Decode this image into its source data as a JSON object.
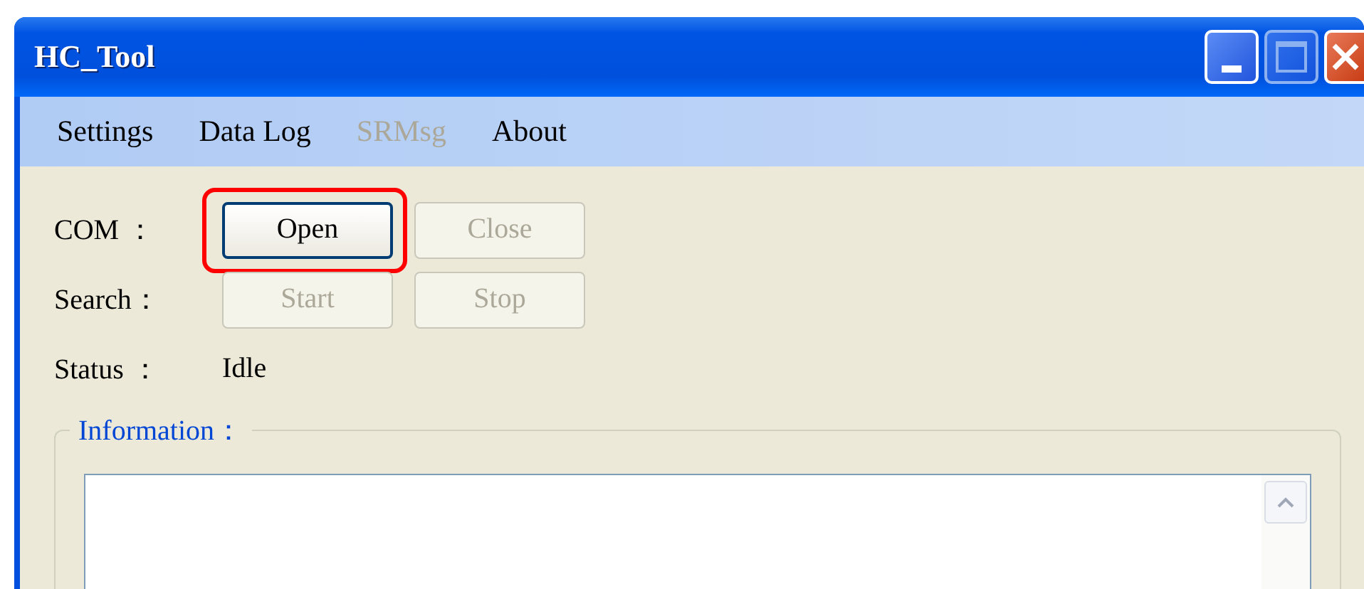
{
  "window": {
    "title": "HC_Tool"
  },
  "menu": [
    {
      "label": "Settings",
      "disabled": false
    },
    {
      "label": "Data Log",
      "disabled": false
    },
    {
      "label": "SRMsg",
      "disabled": true
    },
    {
      "label": "About",
      "disabled": false
    }
  ],
  "rows": [
    {
      "label": "COM ：",
      "kind": "buttons",
      "buttons": [
        {
          "label": "Open",
          "disabled": false,
          "highlighted": true
        },
        {
          "label": "Close",
          "disabled": true,
          "highlighted": false
        }
      ]
    },
    {
      "label": "Search：",
      "kind": "buttons",
      "buttons": [
        {
          "label": "Start",
          "disabled": true,
          "highlighted": false
        },
        {
          "label": "Stop",
          "disabled": true,
          "highlighted": false
        }
      ]
    },
    {
      "label": "Status ：",
      "kind": "value",
      "value": "Idle"
    }
  ],
  "information": {
    "title": "Information："
  }
}
